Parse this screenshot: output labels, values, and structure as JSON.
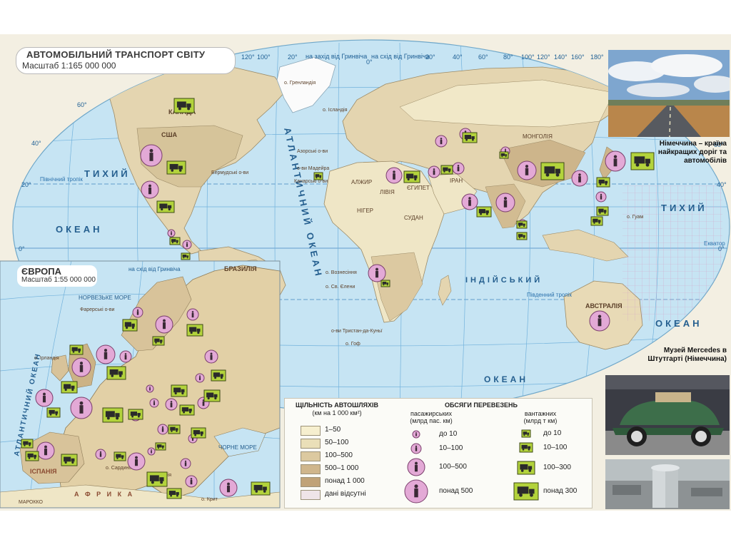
{
  "map": {
    "title": "АВТОМОБІЛЬНИЙ ТРАНСПОРТ СВІТУ",
    "scale": "Масштаб 1:165 000 000",
    "meridian_west": "на захід від Гринвіча",
    "meridian_east": "на схід від Гринвіча",
    "lon_labels": [
      "120°",
      "100°",
      "80°",
      "60°",
      "40°",
      "20°",
      "0°",
      "20°",
      "40°",
      "60°",
      "80°",
      "100°",
      "120°",
      "140°",
      "160°",
      "180°"
    ],
    "lat_labels": [
      "60°",
      "40°",
      "20°",
      "0°",
      "20°",
      "40°"
    ],
    "ocean_labels": {
      "pacific_west_1": "ТИХИЙ",
      "pacific_west_2": "ОКЕАН",
      "pacific_east_1": "ТИХИЙ",
      "pacific_east_2": "ОКЕАН",
      "atlantic": "АТЛАНТИЧНИЙ ОКЕАН",
      "indian_1": "ІНДІЙСЬКИЙ",
      "indian_2": "ОКЕАН",
      "tropic_n": "Північний тропік",
      "tropic_s": "Південний тропік",
      "equator": "Екватор"
    },
    "place_labels": [
      "о. Гренландія",
      "о. Ісландія",
      "Бермудські о-ви",
      "Азорські о-ви",
      "о-ви Мадейра",
      "Канарські о-ви",
      "АЛЖИР",
      "ЛІВІЯ",
      "ЄГИПЕТ",
      "НІГЕР",
      "СУДАН",
      "ІРАН",
      "МОНГОЛІЯ",
      "БРАЗИЛІЯ",
      "АВСТРАЛІЯ",
      "о. Вознесіння",
      "о. Св. Єлени",
      "о-ви Тристан-да-Куньї",
      "о. Гоф",
      "о. Гуам",
      "США",
      "КАНАДА"
    ],
    "europe_inset": {
      "title": "ЄВРОПА",
      "scale": "Масштаб 1:55 000 000",
      "meridian_east": "на схід від Гринвіча",
      "atlantic": "АТЛАНТИЧНИЙ ОКЕАН",
      "labels": [
        "НОРВЕЗЬКЕ МОРЕ",
        "Фарерські о-ви",
        "о. Ірландія",
        "ІСПАНІЯ",
        "ЧОРНЕ МОРЕ",
        "о. Сицилія",
        "о. Сардинія",
        "о. Крит",
        "МАРОККО",
        "А Ф Р И К А"
      ]
    }
  },
  "photos": {
    "germany_caption": "Німеччина – країна найкращих доріг та автомобілів",
    "museum_caption": "Музей Mercedes в Штутгарті (Німеччина)"
  },
  "legend": {
    "density_title": "ЩІЛЬНІСТЬ АВТОШЛЯХІВ",
    "density_unit": "(км на 1 000 км²)",
    "density_classes": [
      {
        "label": "1–50",
        "color": "#f6efcf"
      },
      {
        "label": "50–100",
        "color": "#eadfb8"
      },
      {
        "label": "100–500",
        "color": "#dcc9a0"
      },
      {
        "label": "500–1 000",
        "color": "#cfb68c"
      },
      {
        "label": "понад 1 000",
        "color": "#c0a277"
      },
      {
        "label": "дані відсутні",
        "color": "#efe4e8"
      }
    ],
    "volume_title": "ОБСЯГИ ПЕРЕВЕЗЕНЬ",
    "passenger_title": "пасажирських",
    "passenger_unit": "(млрд пас. км)",
    "passenger_classes": [
      "до 10",
      "10–100",
      "100–500",
      "понад 500"
    ],
    "cargo_title": "вантажних",
    "cargo_unit": "(млрд т км)",
    "cargo_classes": [
      "до 10",
      "10–100",
      "100–300",
      "понад 300"
    ]
  },
  "colors": {
    "ocean": "#c5e3f2",
    "land": "#e2d3ae",
    "passenger_symbol": "#e3a9d6",
    "cargo_symbol": "#b3d33c",
    "grid": "#5fa8d5"
  }
}
